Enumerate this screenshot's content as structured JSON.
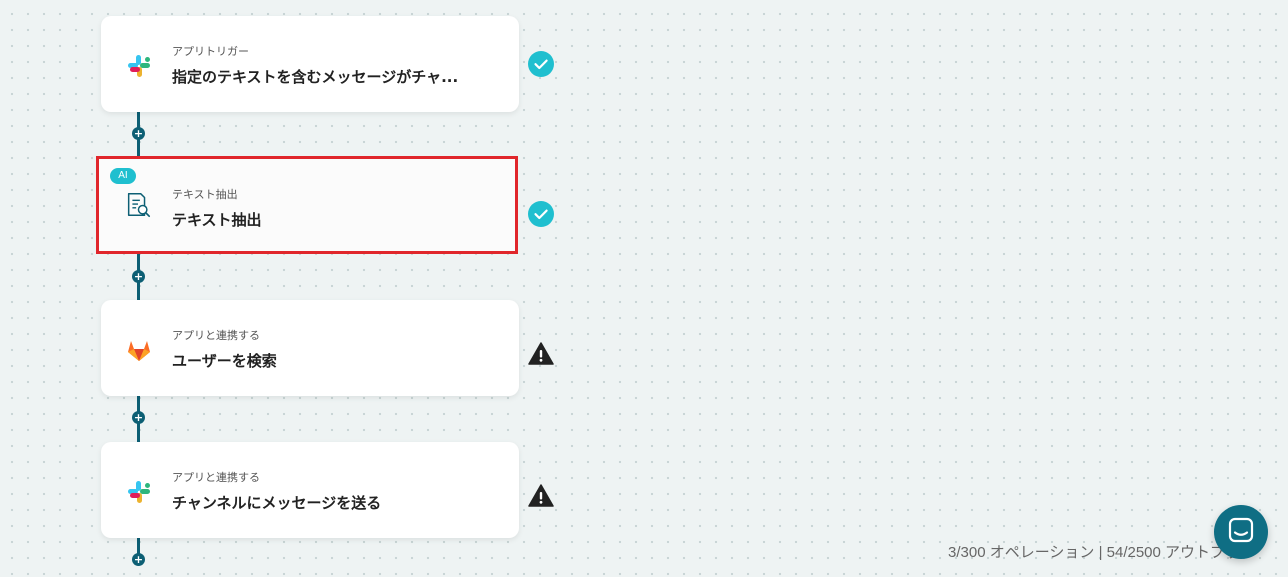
{
  "flow": {
    "steps": [
      {
        "id": "slack-trigger",
        "subtitle": "アプリトリガー",
        "title": "指定のテキストを含むメッセージがチャ...",
        "icon": "slack-icon",
        "status": "complete"
      },
      {
        "id": "text-extraction",
        "badge": "AI",
        "subtitle": "テキスト抽出",
        "title": "テキスト抽出",
        "icon": "document-search-icon",
        "status": "complete",
        "selected": true
      },
      {
        "id": "gitlab-search-user",
        "subtitle": "アプリと連携する",
        "title": "ユーザーを検索",
        "icon": "gitlab-icon",
        "status": "warning"
      },
      {
        "id": "slack-send-message",
        "subtitle": "アプリと連携する",
        "title": "チャンネルにメッセージを送る",
        "icon": "slack-icon",
        "status": "warning"
      }
    ]
  },
  "footer": {
    "usage_text": "3/300 オペレーション | 54/2500 アウトプット"
  },
  "colors": {
    "connector": "#0d5f74",
    "check": "#1fbfcf",
    "warning": "#222222",
    "selected_border": "#e0262b",
    "chat_button": "#0f6e84"
  }
}
